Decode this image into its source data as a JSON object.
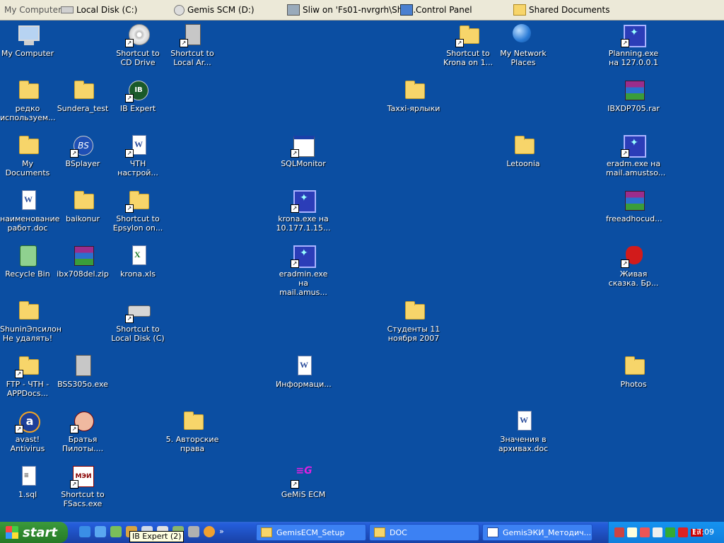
{
  "linksbar": {
    "items": [
      "My Computer",
      "Local Disk (C:)",
      "Gemis SCM (D:)",
      "Sliw on 'Fs01-nvrgrh\\Sha...",
      "Control Panel",
      "Shared Documents"
    ]
  },
  "desktop": {
    "icons": [
      {
        "label": "My Computer",
        "icon": "computer-icon"
      },
      {
        "label": "Shortcut to CD Drive",
        "icon": "cd-drive-icon"
      },
      {
        "label": "Shortcut to Local Ar...",
        "icon": "network-computer-icon"
      },
      {
        "label": "Shortcut to Krona on 1...",
        "icon": "folder-icon"
      },
      {
        "label": "My Network Places",
        "icon": "network-icon"
      },
      {
        "label": "Planning.exe на 127.0.0.1",
        "icon": "app-icon"
      },
      {
        "label": "редко используем...",
        "icon": "folder-icon"
      },
      {
        "label": "Sundera_test",
        "icon": "folder-icon"
      },
      {
        "label": "IB Expert",
        "icon": "ib-expert-icon"
      },
      {
        "label": "Taxxi-ярлыки",
        "icon": "folder-icon"
      },
      {
        "label": "IBXDP705.rar",
        "icon": "rar-icon"
      },
      {
        "label": "My Documents",
        "icon": "documents-icon"
      },
      {
        "label": "BSplayer",
        "icon": "bsplayer-icon"
      },
      {
        "label": "ЧТН настрой...",
        "icon": "word-icon"
      },
      {
        "label": "SQLMonitor",
        "icon": "window-icon"
      },
      {
        "label": "Letoonia",
        "icon": "folder-icon"
      },
      {
        "label": "eradm.exe на mail.amustso...",
        "icon": "app-icon"
      },
      {
        "label": "наименование работ.doc",
        "icon": "word-icon"
      },
      {
        "label": "baikonur",
        "icon": "folder-icon"
      },
      {
        "label": "Shortcut to Epsylon on...",
        "icon": "folder-icon"
      },
      {
        "label": "krona.exe на 10.177.1.15...",
        "icon": "app-icon"
      },
      {
        "label": "freeadhocud...",
        "icon": "rar-icon"
      },
      {
        "label": "Recycle Bin",
        "icon": "recycle-bin-icon"
      },
      {
        "label": "ibx708del.zip",
        "icon": "rar-icon"
      },
      {
        "label": "krona.xls",
        "icon": "excel-icon"
      },
      {
        "label": "eradmin.exe на mail.amus...",
        "icon": "app-icon"
      },
      {
        "label": "Живая сказка. Бр...",
        "icon": "devil-icon"
      },
      {
        "label": "ShuninЭпсилон Не удалять!",
        "icon": "folder-icon"
      },
      {
        "label": "Shortcut to Local Disk (C)",
        "icon": "drive-icon"
      },
      {
        "label": "Студенты 11 ноября 2007",
        "icon": "folder-icon"
      },
      {
        "label": "FTP - ЧТН - APPDocs...",
        "icon": "folder-icon"
      },
      {
        "label": "BSS305o.exe",
        "icon": "computer-tower-icon"
      },
      {
        "label": "Информаци...",
        "icon": "word-icon"
      },
      {
        "label": "Photos",
        "icon": "folder-icon"
      },
      {
        "label": "avast! Antivirus",
        "icon": "avast-icon"
      },
      {
        "label": "Братья Пилоты....",
        "icon": "face-icon"
      },
      {
        "label": "5. Авторские права",
        "icon": "folder-icon"
      },
      {
        "label": "Значения в архивах.doc",
        "icon": "word-icon"
      },
      {
        "label": "1.sql",
        "icon": "text-icon"
      },
      {
        "label": "Shortcut to FSacs.exe",
        "icon": "mei-icon"
      },
      {
        "label": "GeMiS ECM",
        "icon": "gemis-icon"
      }
    ]
  },
  "taskbar": {
    "start_label": "start",
    "tasks": [
      "GemisECM_Setup",
      "DOC",
      "GemisЭКИ_Методич..."
    ],
    "tooltip": "IB Expert (2)",
    "language": "En",
    "clock": "17:09"
  }
}
